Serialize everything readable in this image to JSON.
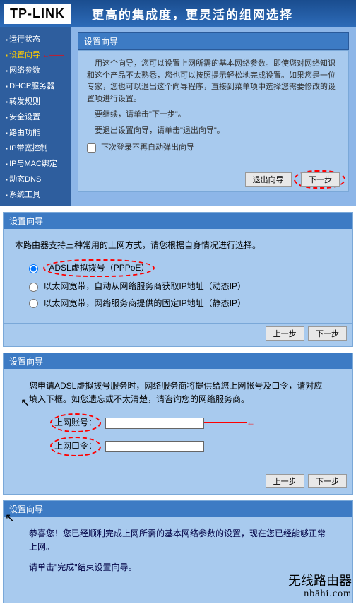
{
  "header": {
    "logo": "TP-LINK",
    "banner": "更高的集成度，更灵活的组网选择"
  },
  "sidebar": {
    "items": [
      {
        "label": "运行状态"
      },
      {
        "label": "设置向导"
      },
      {
        "label": "网络参数"
      },
      {
        "label": "DHCP服务器"
      },
      {
        "label": "转发规则"
      },
      {
        "label": "安全设置"
      },
      {
        "label": "路由功能"
      },
      {
        "label": "IP带宽控制"
      },
      {
        "label": "IP与MAC绑定"
      },
      {
        "label": "动态DNS"
      },
      {
        "label": "系统工具"
      }
    ]
  },
  "panel1": {
    "title": "设置向导",
    "p1": "用这个向导，您可以设置上网所需的基本网络参数。即使您对网络知识和这个产品不太熟悉，您也可以按照提示轻松地完成设置。如果您是一位专家，您也可以退出这个向导程序，直接到菜单项中选择您需要修改的设置项进行设置。",
    "p2": "要继续，请单击\"下一步\"。",
    "p3": "要退出设置向导，请单击\"退出向导\"。",
    "checkbox_label": "下次登录不再自动弹出向导",
    "exit_btn": "退出向导",
    "next_btn": "下一步"
  },
  "panel2": {
    "title": "设置向导",
    "intro": "本路由器支持三种常用的上网方式，请您根据自身情况进行选择。",
    "opt1": "ADSL虚拟拨号（PPPoE）",
    "opt2": "以太网宽带，自动从网络服务商获取IP地址（动态IP）",
    "opt3": "以太网宽带，网络服务商提供的固定IP地址（静态IP）",
    "prev_btn": "上一步",
    "next_btn": "下一步"
  },
  "panel3": {
    "title": "设置向导",
    "intro1": "您申请ADSL虚拟拨号服务时，网络服务商将提供给您上网帐号及口令，请对应填入下框。如您遗忘或不太清楚，请咨询您的网络服务商。",
    "account_label": "上网账号：",
    "password_label": "上网口令：",
    "prev_btn": "上一步",
    "next_btn": "下一步"
  },
  "panel4": {
    "title": "设置向导",
    "p1": "恭喜您！您已经顺利完成上网所需的基本网络参数的设置，现在您已经能够正常上网。",
    "p2": "请单击\"完成\"结束设置向导。"
  },
  "watermark": {
    "line1": "旡线路由器",
    "line2": "nbāhi.com"
  }
}
